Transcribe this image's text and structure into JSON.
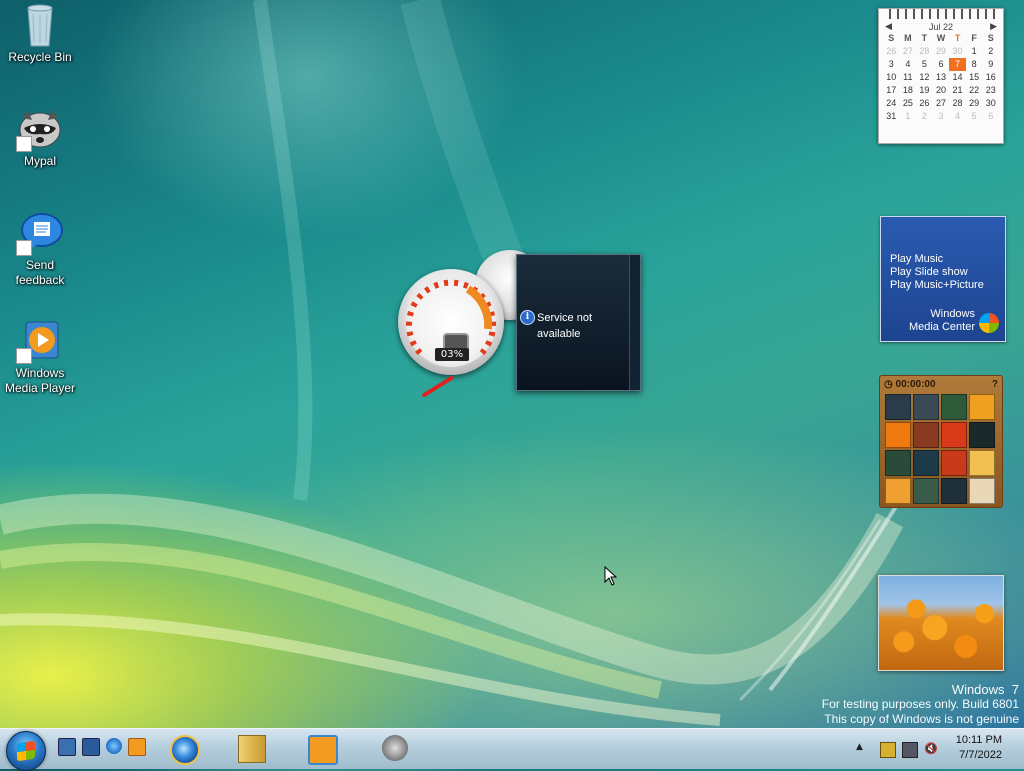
{
  "desktop": {
    "icons": [
      {
        "label": "Recycle Bin",
        "icon": "recycle-bin-icon"
      },
      {
        "label": "Mypal",
        "icon": "raccoon-icon"
      },
      {
        "label": "Send\nfeedback",
        "icon": "feedback-bubble-icon"
      },
      {
        "label": "Windows\nMedia Player",
        "icon": "media-player-icon"
      }
    ]
  },
  "gadgets": {
    "calendar": {
      "month": "Jul 22",
      "weekdays": [
        "S",
        "M",
        "T",
        "W",
        "T",
        "F",
        "S"
      ],
      "weeks": [
        [
          "26",
          "27",
          "28",
          "29",
          "30",
          "1",
          "2"
        ],
        [
          "3",
          "4",
          "5",
          "6",
          "7",
          "8",
          "9"
        ],
        [
          "10",
          "11",
          "12",
          "13",
          "14",
          "15",
          "16"
        ],
        [
          "17",
          "18",
          "19",
          "20",
          "21",
          "22",
          "23"
        ],
        [
          "24",
          "25",
          "26",
          "27",
          "28",
          "29",
          "30"
        ],
        [
          "31",
          "1",
          "2",
          "3",
          "4",
          "5",
          "6"
        ]
      ],
      "today": "7",
      "accent": "#f07020"
    },
    "media_center": {
      "links": [
        "Play Music",
        "Play Slide show",
        "Play Music+Picture"
      ],
      "brand_line1": "Windows",
      "brand_line2": "Media Center"
    },
    "puzzle": {
      "timer": "00:00:00",
      "help_icon": "help-icon",
      "pieces": 15
    },
    "cpu_meter": {
      "value_label": "03%",
      "value_fraction": 0.03
    },
    "flyout": {
      "message_line1": "Service not",
      "message_line2": "available"
    }
  },
  "watermark": {
    "line1": "Windows  7",
    "line2": "For testing purposes only. Build 6801",
    "line3": "This copy of Windows is not genuine"
  },
  "taskbar": {
    "quick_launch": [
      "show-desktop-icon",
      "switch-windows-icon",
      "internet-explorer-icon",
      "media-player-icon"
    ],
    "buttons": [
      "internet-explorer-icon",
      "library-icon",
      "media-player-icon",
      "raccoon-icon"
    ],
    "clock_time": "10:11 PM",
    "clock_date": "7/7/2022"
  }
}
